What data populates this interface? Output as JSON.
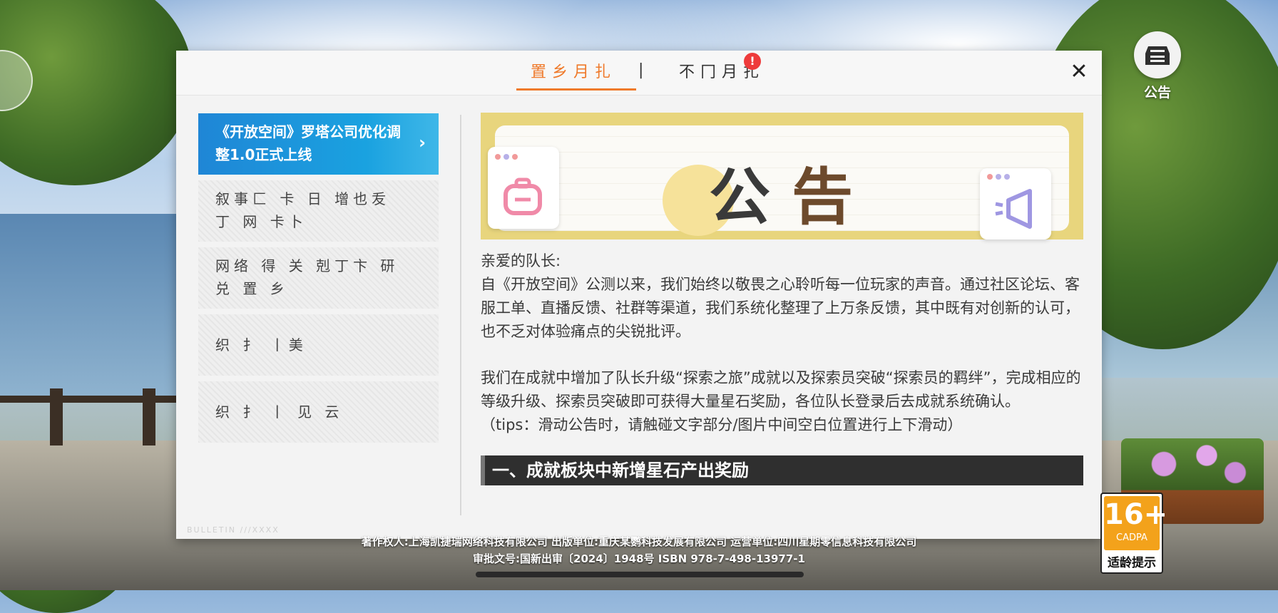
{
  "announce_button": {
    "label": "公告",
    "icon": "bulletin-box-icon"
  },
  "tabs": {
    "active_label": "置乡月扎",
    "separator": "|",
    "inactive_label": "不冂月扎",
    "badge": "!"
  },
  "close_symbol": "✕",
  "sidebar": {
    "items": [
      {
        "label": "《开放空间》罗塔公司优化调整1.0正式上线",
        "active": true
      },
      {
        "label": "叙事匚 卡 日 增也叐 丁 网 卡卜"
      },
      {
        "label": "网络 得 关 剋丁卞 研 兑 置 乡"
      },
      {
        "label": "织 扌 丨美"
      },
      {
        "label": "织 扌 丨 见 云"
      }
    ],
    "chevron": "›",
    "footer_tag": "BULLETIN ///XXXX"
  },
  "banner": {
    "title_1": "公",
    "title_2": "告"
  },
  "article": {
    "greeting": "亲爱的队长:",
    "p1": "自《开放空间》公测以来，我们始终以敬畏之心聆听每一位玩家的声音。通过社区论坛、客服工单、直播反馈、社群等渠道，我们系统化整理了上万条反馈，其中既有对创新的认可，也不乏对体验痛点的尖锐批评。",
    "p2": "我们在成就中增加了队长升级“探索之旅”成就以及探索员突破“探索员的羁绊”，完成相应的等级升级、探索员突破即可获得大量星石奖励，各位队长登录后去成就系统确认。",
    "tips": "（tips：滑动公告时，请触碰文字部分/图片中间空白位置进行上下滑动）",
    "section1": "一、成就板块中新增星石产出奖励"
  },
  "footer": {
    "line1": "著作权人:上海凯捷瑞网络科技有限公司 出版单位:重庆某鹦科技发展有限公司 运营单位:四川星期零信息科技有限公司",
    "line2": "审批文号:国新出审〔2024〕1948号  ISBN 978-7-498-13977-1"
  },
  "age_rating": {
    "number": "16+",
    "org": "CADPA",
    "label": "适龄提示"
  },
  "colors": {
    "accent": "#ef7a2b",
    "active_item": "#1f86d6",
    "badge": "#ee3b3b"
  }
}
